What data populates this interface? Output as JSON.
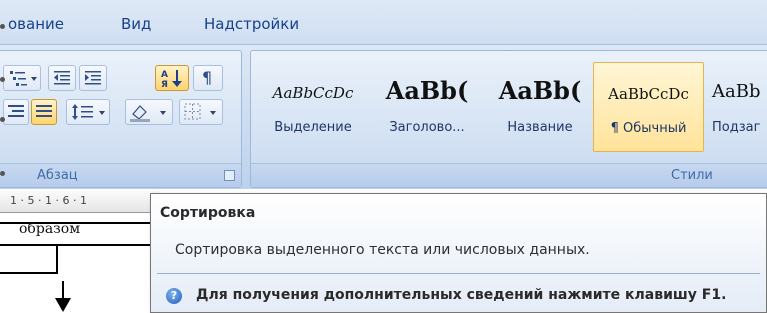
{
  "tabs": [
    "ование",
    "Вид",
    "Надстройки"
  ],
  "paragraph_group": {
    "label": "Абзац",
    "tools": {
      "multilevel_list": "multilevel-list-icon",
      "decrease_indent": "decrease-indent-icon",
      "increase_indent": "increase-indent-icon",
      "sort_icon_text": "А\nЯ",
      "pilcrow": "¶",
      "align_right": "align-right-icon",
      "justify": "justify-icon",
      "line_spacing": "line-spacing-icon",
      "shading": "shading-icon",
      "borders": "borders-icon"
    }
  },
  "styles_group": {
    "label": "Стили",
    "items": [
      {
        "sample": "AaBbCcDc",
        "name": "Выделение"
      },
      {
        "sample": "AaBb(",
        "name": "Заголово..."
      },
      {
        "sample": "AaBb(",
        "name": "Название"
      },
      {
        "sample": "AaBbCcDc",
        "name": "¶ Обычный"
      },
      {
        "sample": "AaBb",
        "name": "Подзаг"
      }
    ]
  },
  "ruler": {
    "marks": "1 · 5 · 1 · 6 · 1"
  },
  "document": {
    "text": "образом"
  },
  "tooltip": {
    "title": "Сортировка",
    "description": "Сортировка выделенного текста или числовых данных.",
    "help": "Для получения дополнительных сведений нажмите клавишу F1."
  },
  "colors": {
    "ribbon": "#c5d7ee",
    "tab_text": "#15428b",
    "highlight": "#ffd36b",
    "selected_style": "#ffe39a"
  }
}
